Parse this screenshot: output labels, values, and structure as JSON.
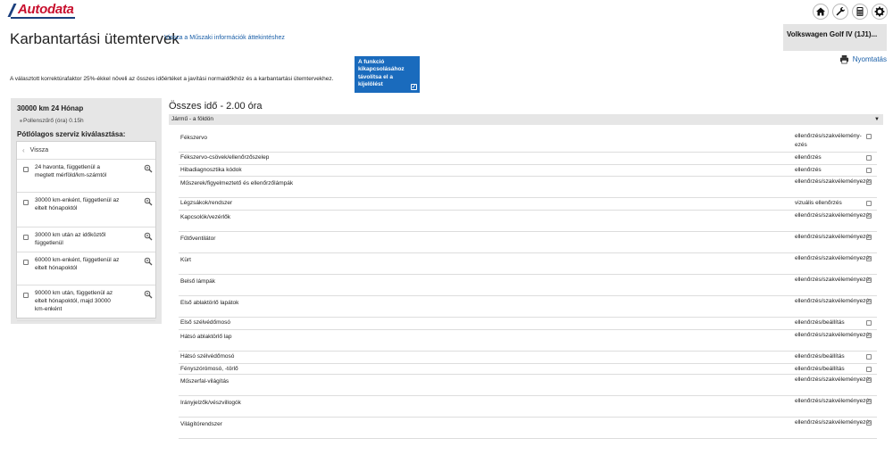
{
  "header": {
    "logo_text": "Autodata",
    "icons": [
      "home-icon",
      "wrench-icon",
      "calculator-icon",
      "gear-icon"
    ]
  },
  "page": {
    "title": "Karbantartási ütemtervek",
    "back_link": "Vissza a Műszaki információk áttekintéshez",
    "vehicle": "Volkswagen Golf IV (1J1)...",
    "print_label": "Nyomtatás",
    "info_text": "A választott korrektúrafaktor 25%-ékkel növeli az összes időértéket a javítási normaidőkhöz és a karbantartási ütemtervekhez.",
    "toggle_button": "A funkció kikapcsolásához távolítsa el a kijelölést"
  },
  "left_panel": {
    "title": "30000 km 24 Hónap",
    "filter": "Pollenszűrő (óra) 0.15h",
    "subtitle": "Pótlólagos szerviz kiválasztása:",
    "back": "Vissza",
    "items": [
      {
        "label": "24 havonta, függetlenül a megtett mérföld/km-számtól"
      },
      {
        "label": "30000 km-enként, függetlenül az eltelt hónapoktól"
      },
      {
        "label": "30000 km után az időköztől függetlenül"
      },
      {
        "label": "60000 km-enként, függetlenül az eltelt hónapoktól"
      },
      {
        "label": "90000 km után, függetlenül az eltelt hónapoktól, majd 30000 km-enként"
      }
    ]
  },
  "main": {
    "total_time": "Összes idő - 2.00 óra",
    "category": "Jármű - a földön",
    "tasks": [
      {
        "name": "Fékszervo",
        "action": "ellenőrzés/szakvélemény­ezés"
      },
      {
        "name": "Fékszervo-csövek/ellenőrzőszelep",
        "action": "ellenőrzés"
      },
      {
        "name": "Hibadiagnosztika kódok",
        "action": "ellenőrzés"
      },
      {
        "name": "Műszerek/figyelmeztető és ellenőrzőlámpák",
        "action": "ellenőrzés/szakvéleményezés"
      },
      {
        "name": "Légzsákok/rendszer",
        "action": "vizuális ellenőrzés"
      },
      {
        "name": "Kapcsolók/vezérlők",
        "action": "ellenőrzés/szakvéleményezés"
      },
      {
        "name": "Fűtőventilátor",
        "action": "ellenőrzés/szakvéleményezés"
      },
      {
        "name": "Kürt",
        "action": "ellenőrzés/szakvéleményezés"
      },
      {
        "name": "Belső lámpák",
        "action": "ellenőrzés/szakvéleményezés"
      },
      {
        "name": "Első ablaktörlő lapátok",
        "action": "ellenőrzés/szakvéleményezés"
      },
      {
        "name": "Első szélvédőmosó",
        "action": "ellenőrzés/beállítás"
      },
      {
        "name": "Hátsó ablaktörlő lap",
        "action": "ellenőrzés/szakvéleményezés"
      },
      {
        "name": "Hátsó szélvédőmosó",
        "action": "ellenőrzés/beállítás"
      },
      {
        "name": "Fényszórómosó, -törlő",
        "action": "ellenőrzés/beállítás"
      },
      {
        "name": "Műszerfal-világítás",
        "action": "ellenőrzés/szakvéleményezés"
      },
      {
        "name": "Irányjelzők/vészvillogók",
        "action": "ellenőrzés/szakvéleményezés"
      },
      {
        "name": "Világítórendszer",
        "action": "ellenőrzés/szakvéleményezés"
      }
    ]
  }
}
